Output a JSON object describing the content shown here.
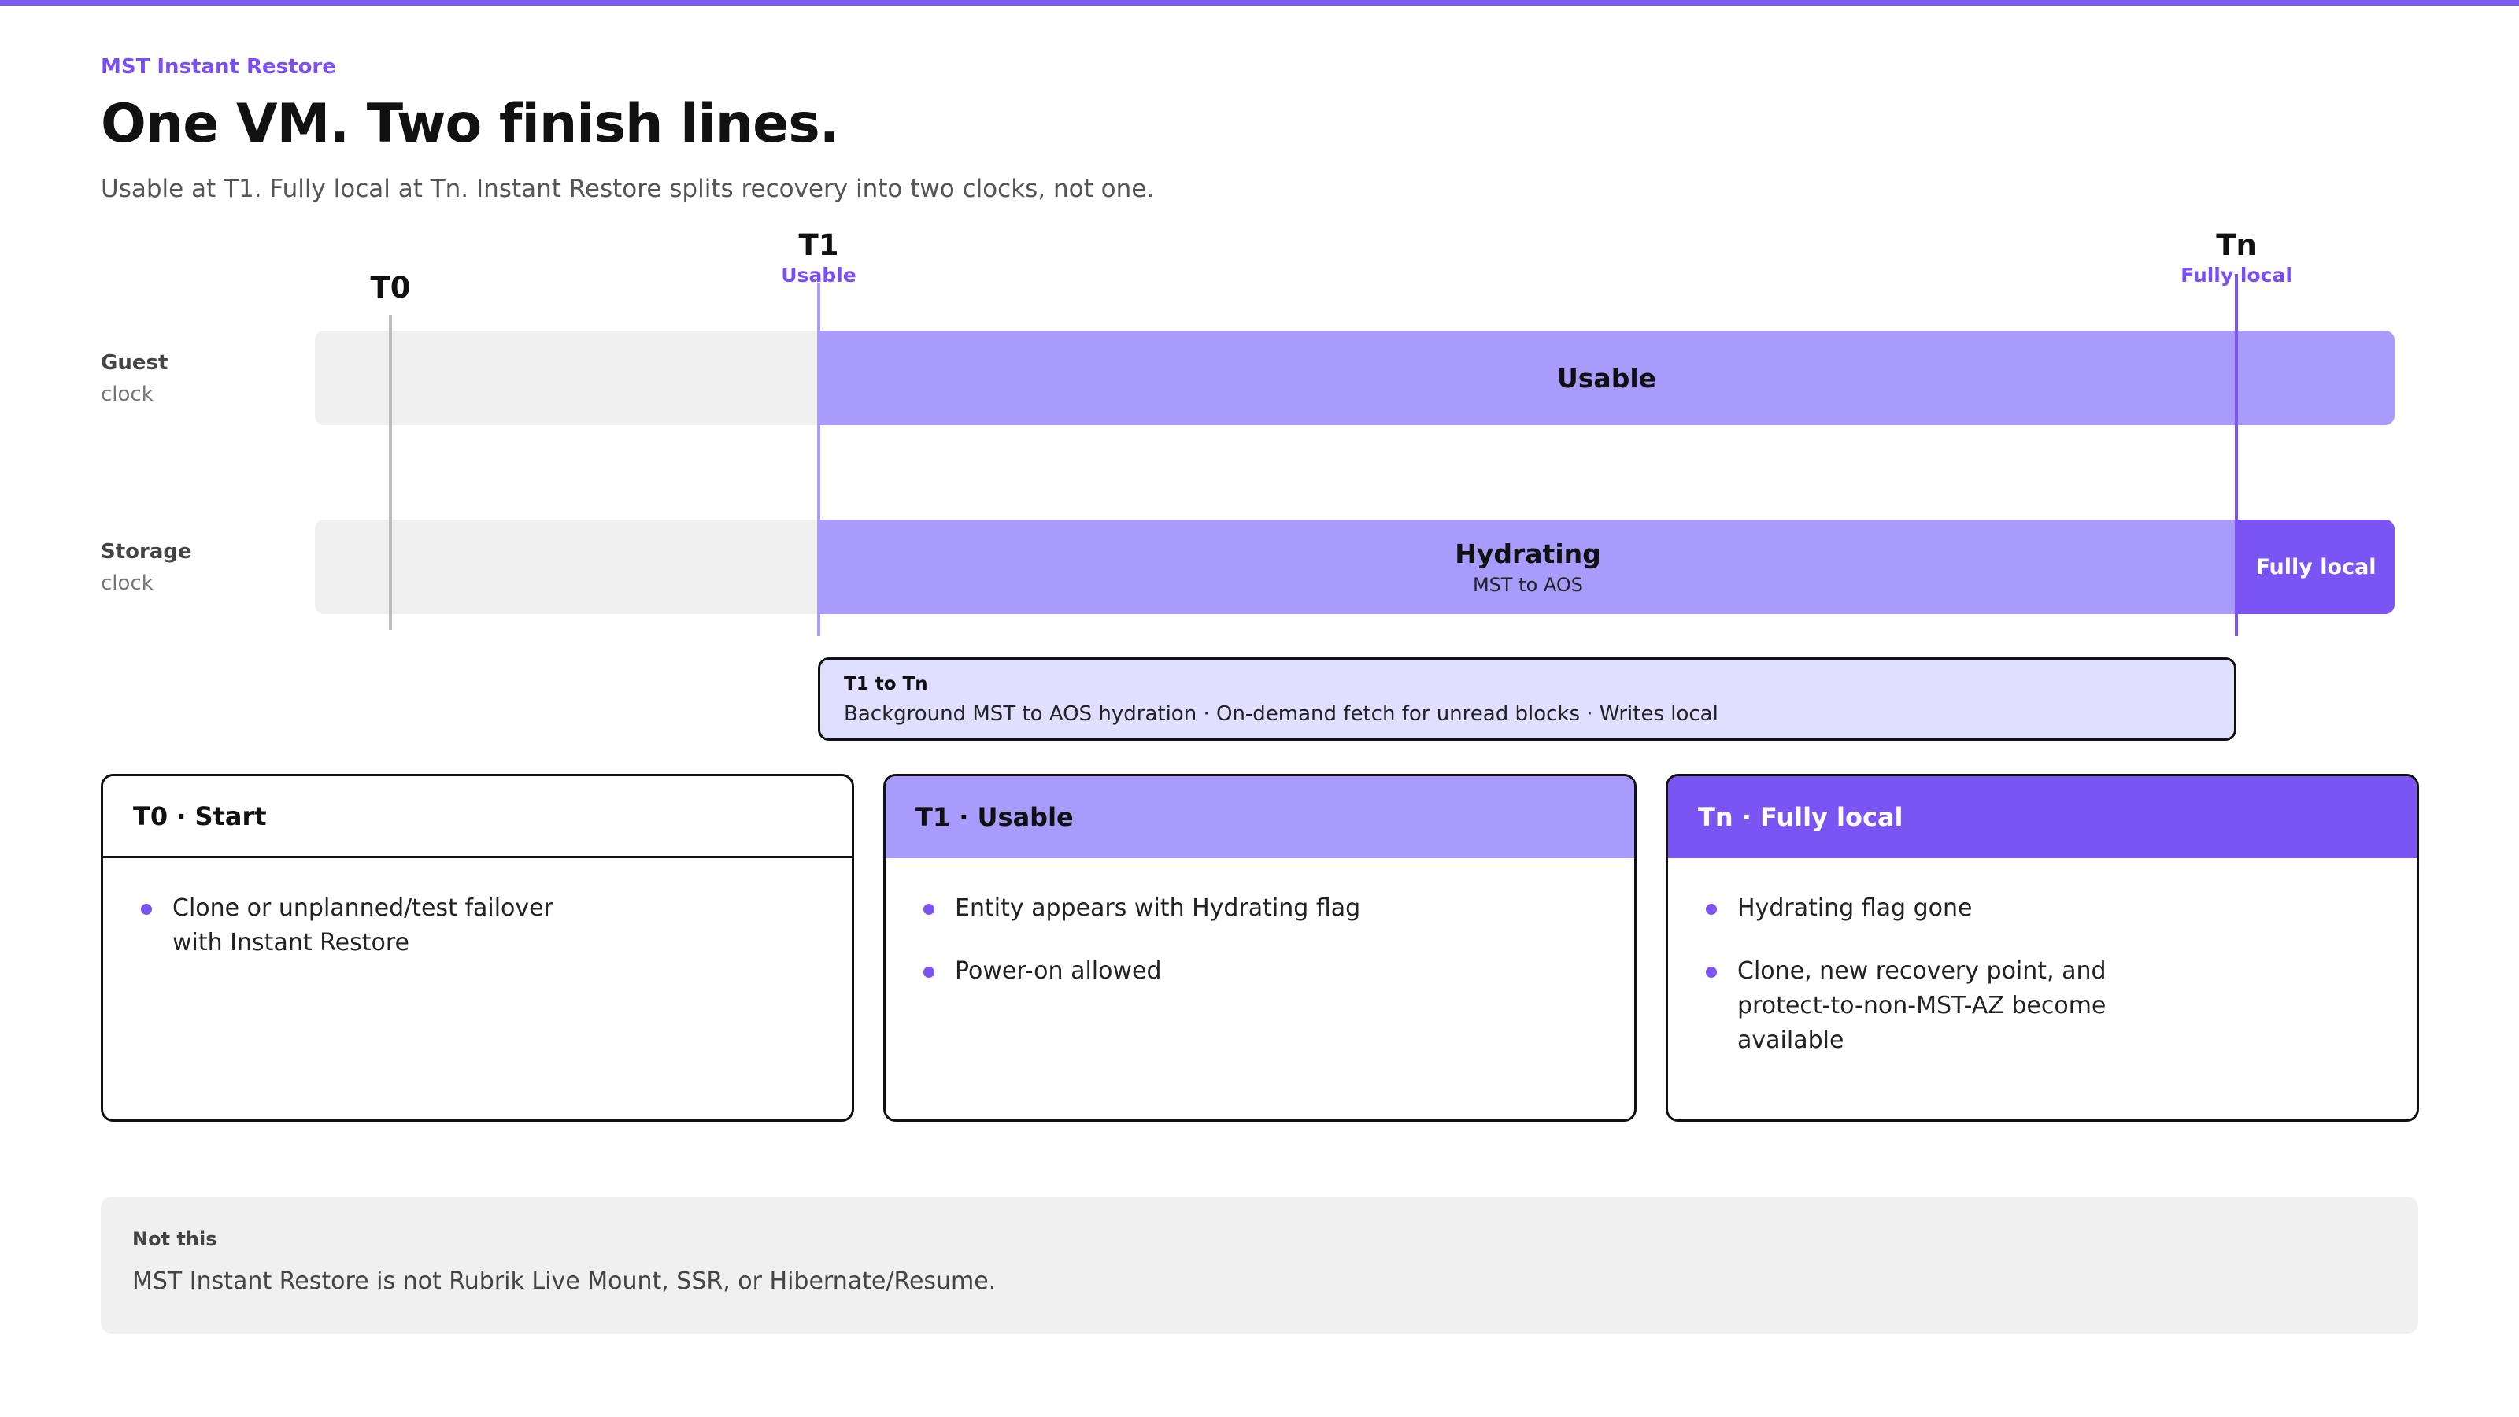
{
  "header": {
    "eyebrow": "MST Instant Restore",
    "title": "One VM. Two finish lines.",
    "subtitle": "Usable at T1. Fully local at Tn. Instant Restore splits recovery into two clocks, not one."
  },
  "timeline": {
    "markers": [
      {
        "name": "T0",
        "sub": ""
      },
      {
        "name": "T1",
        "sub": "Usable"
      },
      {
        "name": "Tn",
        "sub": "Fully local"
      }
    ],
    "rows": [
      {
        "label": "Guest",
        "sublabel": "clock",
        "segments": [
          {
            "label": "Usable",
            "sub": ""
          }
        ]
      },
      {
        "label": "Storage",
        "sublabel": "clock",
        "segments": [
          {
            "label": "Hydrating",
            "sub": "MST to AOS"
          },
          {
            "label": "Fully local",
            "sub": ""
          }
        ]
      }
    ],
    "callout": {
      "title": "T1 to Tn",
      "body": "Background MST to AOS hydration · On-demand fetch for unread blocks · Writes local"
    },
    "colors": {
      "light": "#a99bfb",
      "dark": "#7b55f3",
      "track": "#f0f0f0",
      "accent": "#7b4ff2"
    }
  },
  "cards": [
    {
      "title": "T0 · Start",
      "bullets": [
        "Clone or unplanned/test failover\nwith Instant Restore"
      ]
    },
    {
      "title": "T1 · Usable",
      "bullets": [
        "Entity appears with Hydrating flag",
        "Power-on allowed"
      ]
    },
    {
      "title": "Tn · Fully local",
      "bullets": [
        "Hydrating flag gone",
        "Clone, new recovery point, and\nprotect-to-non-MST-AZ become\navailable"
      ]
    }
  ],
  "note": {
    "title": "Not this",
    "body": "MST Instant Restore is not Rubrik Live Mount, SSR, or Hibernate/Resume."
  }
}
